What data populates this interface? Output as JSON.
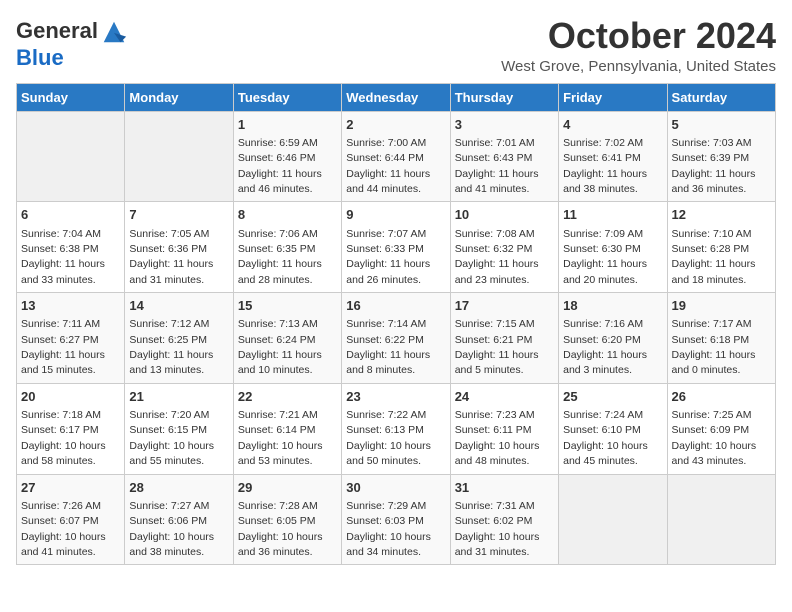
{
  "header": {
    "logo_general": "General",
    "logo_blue": "Blue",
    "month_title": "October 2024",
    "location": "West Grove, Pennsylvania, United States"
  },
  "weekdays": [
    "Sunday",
    "Monday",
    "Tuesday",
    "Wednesday",
    "Thursday",
    "Friday",
    "Saturday"
  ],
  "weeks": [
    [
      {
        "day": "",
        "info": ""
      },
      {
        "day": "",
        "info": ""
      },
      {
        "day": "1",
        "info": "Sunrise: 6:59 AM\nSunset: 6:46 PM\nDaylight: 11 hours and 46 minutes."
      },
      {
        "day": "2",
        "info": "Sunrise: 7:00 AM\nSunset: 6:44 PM\nDaylight: 11 hours and 44 minutes."
      },
      {
        "day": "3",
        "info": "Sunrise: 7:01 AM\nSunset: 6:43 PM\nDaylight: 11 hours and 41 minutes."
      },
      {
        "day": "4",
        "info": "Sunrise: 7:02 AM\nSunset: 6:41 PM\nDaylight: 11 hours and 38 minutes."
      },
      {
        "day": "5",
        "info": "Sunrise: 7:03 AM\nSunset: 6:39 PM\nDaylight: 11 hours and 36 minutes."
      }
    ],
    [
      {
        "day": "6",
        "info": "Sunrise: 7:04 AM\nSunset: 6:38 PM\nDaylight: 11 hours and 33 minutes."
      },
      {
        "day": "7",
        "info": "Sunrise: 7:05 AM\nSunset: 6:36 PM\nDaylight: 11 hours and 31 minutes."
      },
      {
        "day": "8",
        "info": "Sunrise: 7:06 AM\nSunset: 6:35 PM\nDaylight: 11 hours and 28 minutes."
      },
      {
        "day": "9",
        "info": "Sunrise: 7:07 AM\nSunset: 6:33 PM\nDaylight: 11 hours and 26 minutes."
      },
      {
        "day": "10",
        "info": "Sunrise: 7:08 AM\nSunset: 6:32 PM\nDaylight: 11 hours and 23 minutes."
      },
      {
        "day": "11",
        "info": "Sunrise: 7:09 AM\nSunset: 6:30 PM\nDaylight: 11 hours and 20 minutes."
      },
      {
        "day": "12",
        "info": "Sunrise: 7:10 AM\nSunset: 6:28 PM\nDaylight: 11 hours and 18 minutes."
      }
    ],
    [
      {
        "day": "13",
        "info": "Sunrise: 7:11 AM\nSunset: 6:27 PM\nDaylight: 11 hours and 15 minutes."
      },
      {
        "day": "14",
        "info": "Sunrise: 7:12 AM\nSunset: 6:25 PM\nDaylight: 11 hours and 13 minutes."
      },
      {
        "day": "15",
        "info": "Sunrise: 7:13 AM\nSunset: 6:24 PM\nDaylight: 11 hours and 10 minutes."
      },
      {
        "day": "16",
        "info": "Sunrise: 7:14 AM\nSunset: 6:22 PM\nDaylight: 11 hours and 8 minutes."
      },
      {
        "day": "17",
        "info": "Sunrise: 7:15 AM\nSunset: 6:21 PM\nDaylight: 11 hours and 5 minutes."
      },
      {
        "day": "18",
        "info": "Sunrise: 7:16 AM\nSunset: 6:20 PM\nDaylight: 11 hours and 3 minutes."
      },
      {
        "day": "19",
        "info": "Sunrise: 7:17 AM\nSunset: 6:18 PM\nDaylight: 11 hours and 0 minutes."
      }
    ],
    [
      {
        "day": "20",
        "info": "Sunrise: 7:18 AM\nSunset: 6:17 PM\nDaylight: 10 hours and 58 minutes."
      },
      {
        "day": "21",
        "info": "Sunrise: 7:20 AM\nSunset: 6:15 PM\nDaylight: 10 hours and 55 minutes."
      },
      {
        "day": "22",
        "info": "Sunrise: 7:21 AM\nSunset: 6:14 PM\nDaylight: 10 hours and 53 minutes."
      },
      {
        "day": "23",
        "info": "Sunrise: 7:22 AM\nSunset: 6:13 PM\nDaylight: 10 hours and 50 minutes."
      },
      {
        "day": "24",
        "info": "Sunrise: 7:23 AM\nSunset: 6:11 PM\nDaylight: 10 hours and 48 minutes."
      },
      {
        "day": "25",
        "info": "Sunrise: 7:24 AM\nSunset: 6:10 PM\nDaylight: 10 hours and 45 minutes."
      },
      {
        "day": "26",
        "info": "Sunrise: 7:25 AM\nSunset: 6:09 PM\nDaylight: 10 hours and 43 minutes."
      }
    ],
    [
      {
        "day": "27",
        "info": "Sunrise: 7:26 AM\nSunset: 6:07 PM\nDaylight: 10 hours and 41 minutes."
      },
      {
        "day": "28",
        "info": "Sunrise: 7:27 AM\nSunset: 6:06 PM\nDaylight: 10 hours and 38 minutes."
      },
      {
        "day": "29",
        "info": "Sunrise: 7:28 AM\nSunset: 6:05 PM\nDaylight: 10 hours and 36 minutes."
      },
      {
        "day": "30",
        "info": "Sunrise: 7:29 AM\nSunset: 6:03 PM\nDaylight: 10 hours and 34 minutes."
      },
      {
        "day": "31",
        "info": "Sunrise: 7:31 AM\nSunset: 6:02 PM\nDaylight: 10 hours and 31 minutes."
      },
      {
        "day": "",
        "info": ""
      },
      {
        "day": "",
        "info": ""
      }
    ]
  ]
}
